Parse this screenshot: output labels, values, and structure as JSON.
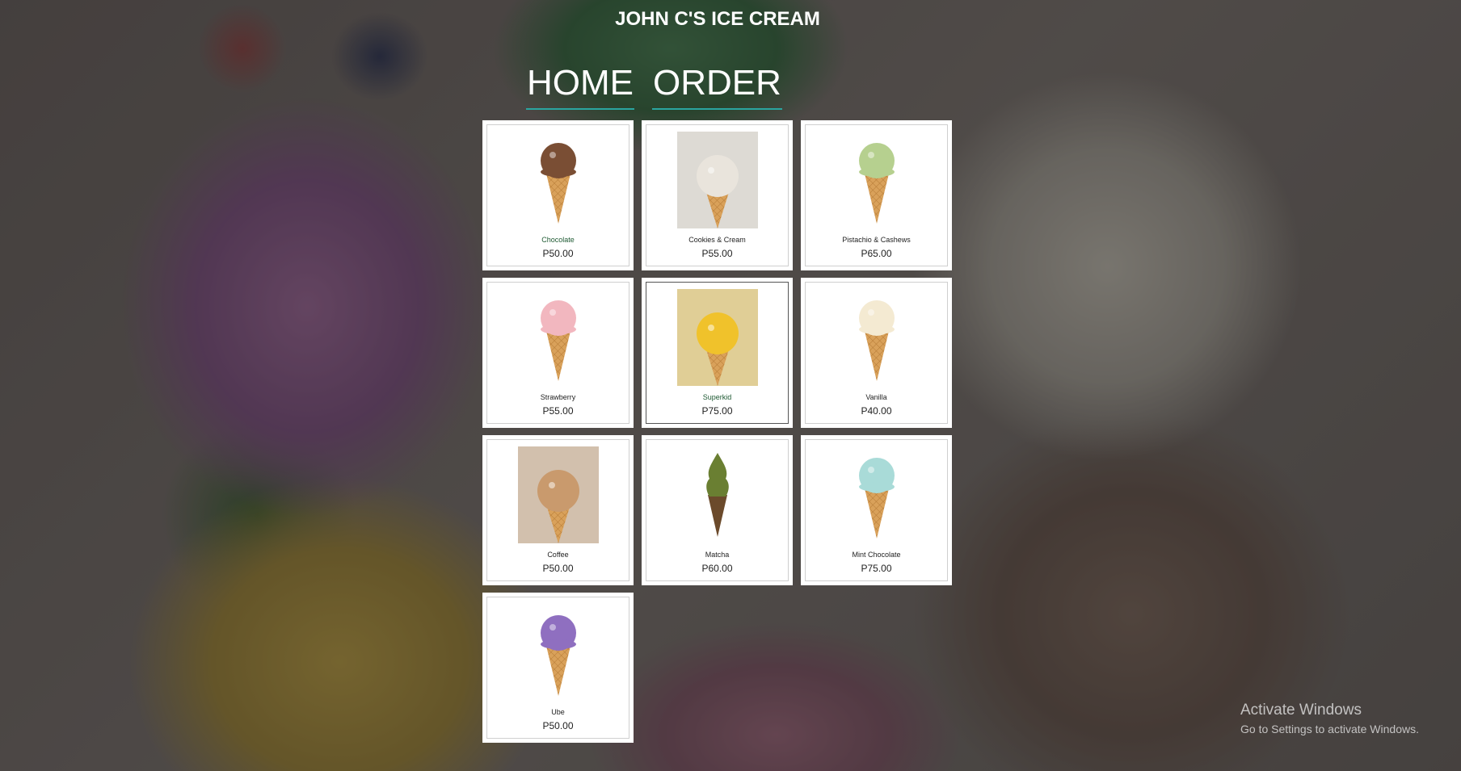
{
  "header": {
    "title": "JOHN C'S ICE CREAM"
  },
  "nav": {
    "home": "HOME",
    "order": "ORDER"
  },
  "products": [
    {
      "name": "Chocolate",
      "price": "P50.00",
      "scoop": "#7a4e34",
      "style": "cone"
    },
    {
      "name": "Cookies & Cream",
      "price": "P55.00",
      "scoop": "#e9e4dc",
      "style": "photo"
    },
    {
      "name": "Pistachio & Cashews",
      "price": "P65.00",
      "scoop": "#b6d08f",
      "style": "cone"
    },
    {
      "name": "Strawberry",
      "price": "P55.00",
      "scoop": "#f2b7bf",
      "style": "cone"
    },
    {
      "name": "Superkid",
      "price": "P75.00",
      "scoop": "#f0c22b",
      "style": "photo"
    },
    {
      "name": "Vanilla",
      "price": "P40.00",
      "scoop": "#f4ead2",
      "style": "cone"
    },
    {
      "name": "Coffee",
      "price": "P50.00",
      "scoop": "#c99a6d",
      "style": "photo"
    },
    {
      "name": "Matcha",
      "price": "P60.00",
      "scoop": "#6a7f32",
      "style": "soft"
    },
    {
      "name": "Mint Chocolate",
      "price": "P75.00",
      "scoop": "#a9dbd8",
      "style": "cone"
    },
    {
      "name": "Ube",
      "price": "P50.00",
      "scoop": "#8f6fc0",
      "style": "cone"
    }
  ],
  "colors": {
    "accent_underline": "#2aa5a0",
    "card_bg": "#ffffff"
  },
  "watermark": {
    "line1": "Activate Windows",
    "line2": "Go to Settings to activate Windows."
  }
}
